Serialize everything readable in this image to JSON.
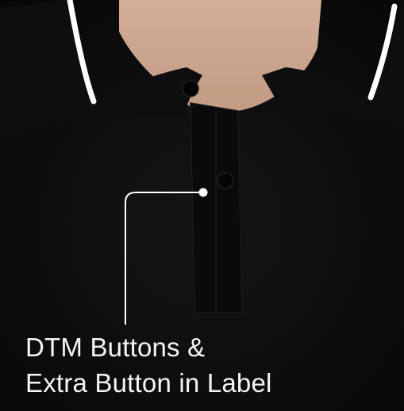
{
  "caption": {
    "line1": "DTM Buttons &",
    "line2": "Extra Button in Label"
  },
  "colors": {
    "shirt": "#0c0c0e",
    "skin": "#c9a48e",
    "collar_tipping": "#ffffff",
    "background_corner": "#b7cfd6",
    "callout": "#ffffff",
    "caption_text": "#f4f4f4"
  },
  "icons": {
    "callout_marker": "pointer-dot-icon"
  }
}
